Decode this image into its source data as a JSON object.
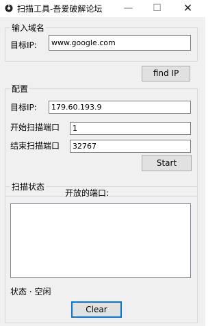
{
  "window": {
    "title": "扫描工具-吾爱破解论坛",
    "minimize_glyph": "—",
    "maximize_glyph": "☐",
    "close_glyph": "✕"
  },
  "domain_group": {
    "legend": "输入域名",
    "target_ip_label": "目标IP:",
    "domain_value": "www.google.com",
    "find_ip_button": "find IP"
  },
  "config_group": {
    "legend": "配置",
    "target_ip_label": "目标IP:",
    "target_ip_value": "179.60.193.9",
    "start_port_label": "开始扫描端口",
    "start_port_value": "1",
    "end_port_label": "结束扫描端口",
    "end_port_value": "32767",
    "start_button": "Start"
  },
  "status_group": {
    "legend": "扫描状态",
    "open_ports_label": "开放的端口:",
    "open_ports": [],
    "status_text": "状态 · 空闲",
    "clear_button": "Clear"
  }
}
